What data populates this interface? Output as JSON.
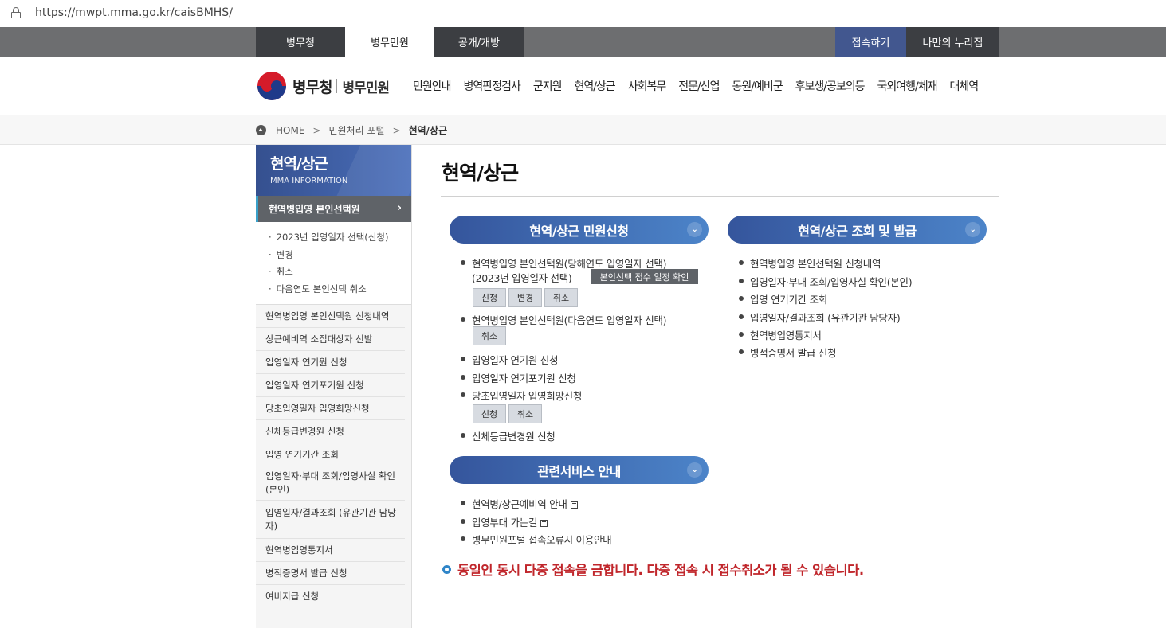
{
  "browser": {
    "url": "https://mwpt.mma.go.kr/caisBMHS/"
  },
  "topbar": {
    "tabs": [
      "병무청",
      "병무민원",
      "공개/개방"
    ],
    "login": "접속하기",
    "mine": "나만의 누리집"
  },
  "header": {
    "logo_main": "병무청",
    "logo_sub": "병무민원",
    "gnb": [
      "민원안내",
      "병역판정검사",
      "군지원",
      "현역/상근",
      "사회복무",
      "전문/산업",
      "동원/예비군",
      "후보생/공보의등",
      "국외여행/체재",
      "대체역"
    ]
  },
  "breadcrumb": {
    "home": "HOME",
    "mid": "민원처리 포털",
    "current": "현역/상근"
  },
  "sidebar": {
    "title": "현역/상근",
    "subtitle": "MMA INFORMATION",
    "selected": "현역병입영 본인선택원",
    "sub_items": [
      "2023년 입영일자 선택(신청)",
      "변경",
      "취소",
      "다음연도 본인선택 취소"
    ],
    "items": [
      "현역병입영 본인선택원 신청내역",
      "상근예비역 소집대상자 선발",
      "입영일자 연기원 신청",
      "입영일자 연기포기원 신청",
      "당초입영일자 입영희망신청",
      "신체등급변경원 신청",
      "입영 연기기간 조회",
      "입영일자·부대 조회/입영사실 확인(본인)",
      "입영일자/결과조회 (유관기관 담당자)",
      "현역병입영통지서",
      "병적증명서 발급 신청",
      "여비지급 신청"
    ]
  },
  "main": {
    "title": "현역/상근",
    "section1": {
      "title": "현역/상근 민원신청",
      "item1_line1": "현역병입영 본인선택원(당해연도 입영일자 선택)",
      "item1_line2": "(2023년 입영일자 선택)",
      "schedule_btn": "본인선택 접수 일정 확인",
      "btn_apply": "신청",
      "btn_change": "변경",
      "btn_cancel": "취소",
      "item2": "현역병입영 본인선택원(다음연도 입영일자 선택)",
      "item3": "입영일자 연기원 신청",
      "item4": "입영일자 연기포기원 신청",
      "item5": "당초입영일자 입영희망신청",
      "item6": "신체등급변경원 신청"
    },
    "section2": {
      "title": "현역/상근 조회 및 발급",
      "items": [
        "현역병입영 본인선택원 신청내역",
        "입영일자·부대 조회/입영사실 확인(본인)",
        "입영 연기기간 조회",
        "입영일자/결과조회 (유관기관 담당자)",
        "현역병입영통지서",
        "병적증명서 발급 신청"
      ]
    },
    "section3": {
      "title": "관련서비스 안내",
      "items": [
        "현역병/상근예비역 안내",
        "입영부대 가는길",
        "병무민원포털 접속오류시 이용안내"
      ]
    },
    "warning": "동일인 동시 다중 접속을 금합니다. 다중 접속 시 접수취소가 될 수 있습니다."
  }
}
